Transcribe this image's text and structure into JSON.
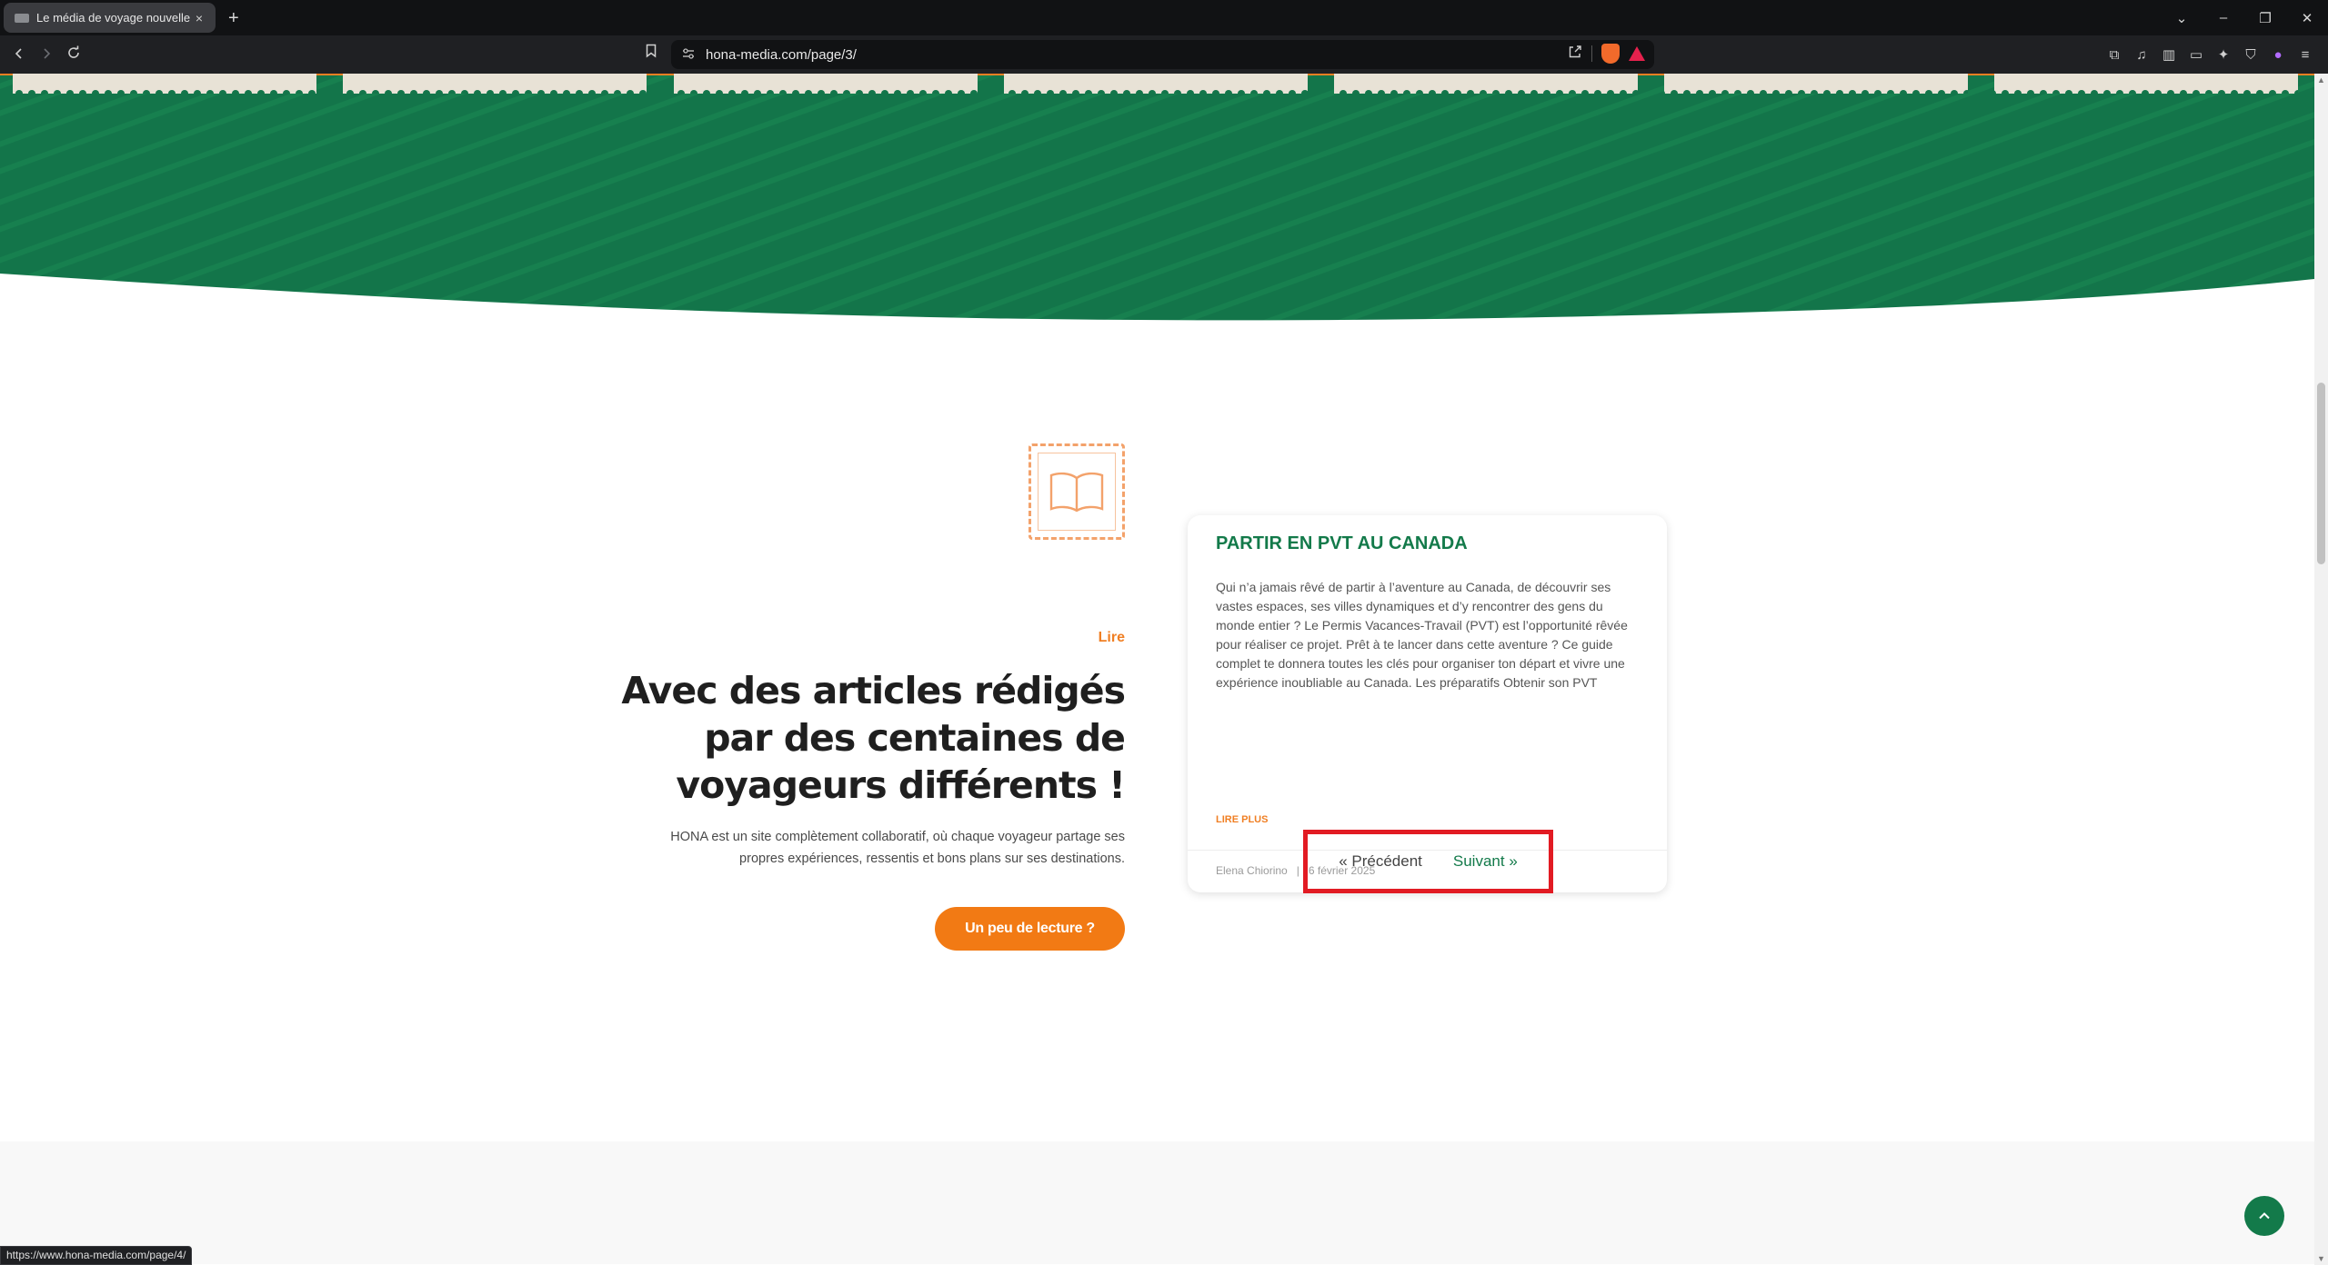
{
  "browser": {
    "tab_title": "Le média de voyage nouvelle g",
    "tab_close": "×",
    "new_tab": "+",
    "url": "hona-media.com/page/3/",
    "status_url": "https://www.hona-media.com/page/4/",
    "window_controls": {
      "dropdown": "⌄",
      "minimize": "–",
      "restore": "❐",
      "close": "✕"
    }
  },
  "section": {
    "kicker": "Lire",
    "heading": "Avec des articles rédigés par des centaines de voyageurs différents !",
    "lead": "HONA est un site complètement collaboratif, où chaque voyageur partage ses propres expériences, ressentis et bons plans sur ses destinations.",
    "cta_label": "Un peu de lecture ?"
  },
  "card": {
    "title": "PARTIR EN PVT AU CANADA",
    "excerpt": "Qui n’a jamais rêvé de partir à l’aventure au Canada, de découvrir ses vastes espaces, ses villes dynamiques et d’y rencontrer des gens du monde entier ? Le Permis Vacances-Travail (PVT) est l’opportunité rêvée pour réaliser ce projet. Prêt à te lancer dans cette aventure ? Ce guide complet te donnera toutes les clés pour organiser ton départ et vivre une expérience inoubliable au Canada. Les préparatifs Obtenir son PVT",
    "read_more": "LIRE PLUS",
    "author": "Elena Chiorino",
    "meta_sep": "|",
    "date": "6 février 2025"
  },
  "pagination": {
    "prev_label": "« Précédent",
    "next_label": "Suivant »"
  },
  "colors": {
    "brand_green": "#137a4a",
    "brand_orange": "#f27a14",
    "highlight_red": "#e21b23"
  },
  "icons": {
    "back": "arrow-left-icon",
    "forward": "arrow-right-icon",
    "reload": "reload-icon",
    "bookmark": "bookmark-icon",
    "site_settings": "tune-icon",
    "share": "share-icon",
    "brave_shields": "brave-shield-icon",
    "brave_rewards": "brave-rewards-icon",
    "book": "open-book-icon",
    "back_to_top": "chevron-up-icon"
  }
}
